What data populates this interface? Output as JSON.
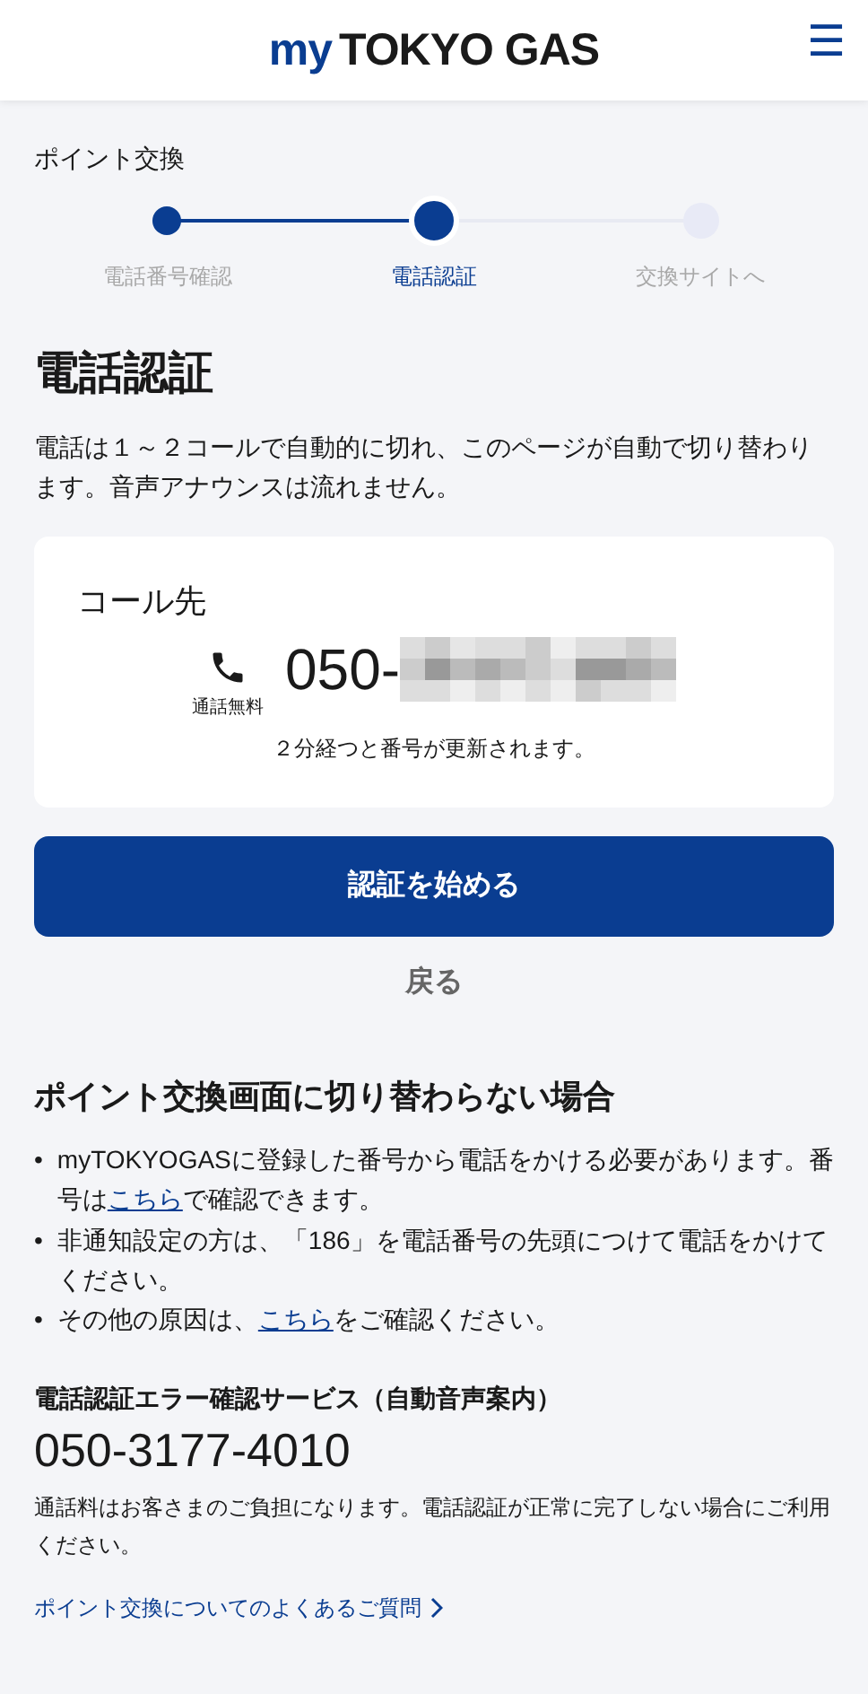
{
  "header": {
    "logo_prefix": "my",
    "logo_main": "TOKYO GAS",
    "menu_icon": "☰"
  },
  "breadcrumb": "ポイント交換",
  "steps": [
    {
      "label": "電話番号確認",
      "done": true,
      "selected": false
    },
    {
      "label": "電話認証",
      "done": false,
      "selected": true
    },
    {
      "label": "交換サイトへ",
      "done": false,
      "selected": false
    }
  ],
  "title": "電話認証",
  "intro": "電話は１～２コールで自動的に切れ、このページが自動で切り替わります。音声アナウンスは流れません。",
  "call_card": {
    "heading": "コール先",
    "free_label": "通話無料",
    "number_prefix": "050-",
    "note": "２分経つと番号が更新されます。"
  },
  "primary_button": "認証を始める",
  "back_link": "戻る",
  "help": {
    "heading": "ポイント交換画面に切り替わらない場合",
    "items": [
      {
        "marker": "•",
        "before": "myTOKYOGASに登録した番号から電話をかける必要があります。番号は",
        "link": "こちら",
        "after": "で確認できます。"
      },
      {
        "marker": "•",
        "before": "非通知設定の方は、「186」を電話番号の先頭につけて電話をかけてください。"
      },
      {
        "marker": "•",
        "before": "その他の原因は、",
        "link": "こちら",
        "after": "をご確認ください。"
      }
    ]
  },
  "error_service": {
    "heading": "電話認証エラー確認サービス（自動音声案内）",
    "number": "050-3177-4010",
    "note": "通話料はお客さまのご負担になります。電話認証が正常に完了しない場合にご利用ください。"
  },
  "faq_link": "ポイント交換についてのよくあるご質問"
}
